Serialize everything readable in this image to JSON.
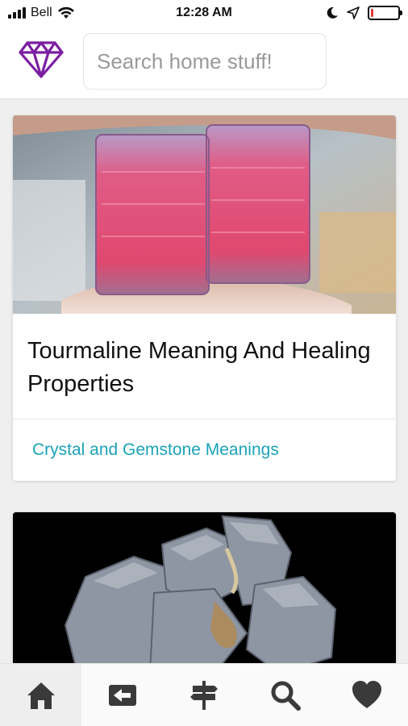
{
  "status_bar": {
    "carrier": "Bell",
    "time": "12:28 AM",
    "battery_level": 0.1
  },
  "header": {
    "logo_icon": "diamond-icon",
    "search_placeholder": "Search home stuff!",
    "brand_color": "#7b1fa2"
  },
  "articles": [
    {
      "title": "Tourmaline Meaning And Healing Properties",
      "category": "Crystal and Gemstone Meanings",
      "image": "pink-tourmaline-crystals-photo"
    },
    {
      "title": "",
      "category": "",
      "image": "gray-galena-mineral-photo"
    }
  ],
  "accent_color": "#1aa3b8",
  "bottom_nav": {
    "items": [
      {
        "icon": "home-icon",
        "active": true
      },
      {
        "icon": "back-icon",
        "active": false
      },
      {
        "icon": "signpost-icon",
        "active": false
      },
      {
        "icon": "search-icon",
        "active": false
      },
      {
        "icon": "heart-icon",
        "active": false
      }
    ]
  }
}
